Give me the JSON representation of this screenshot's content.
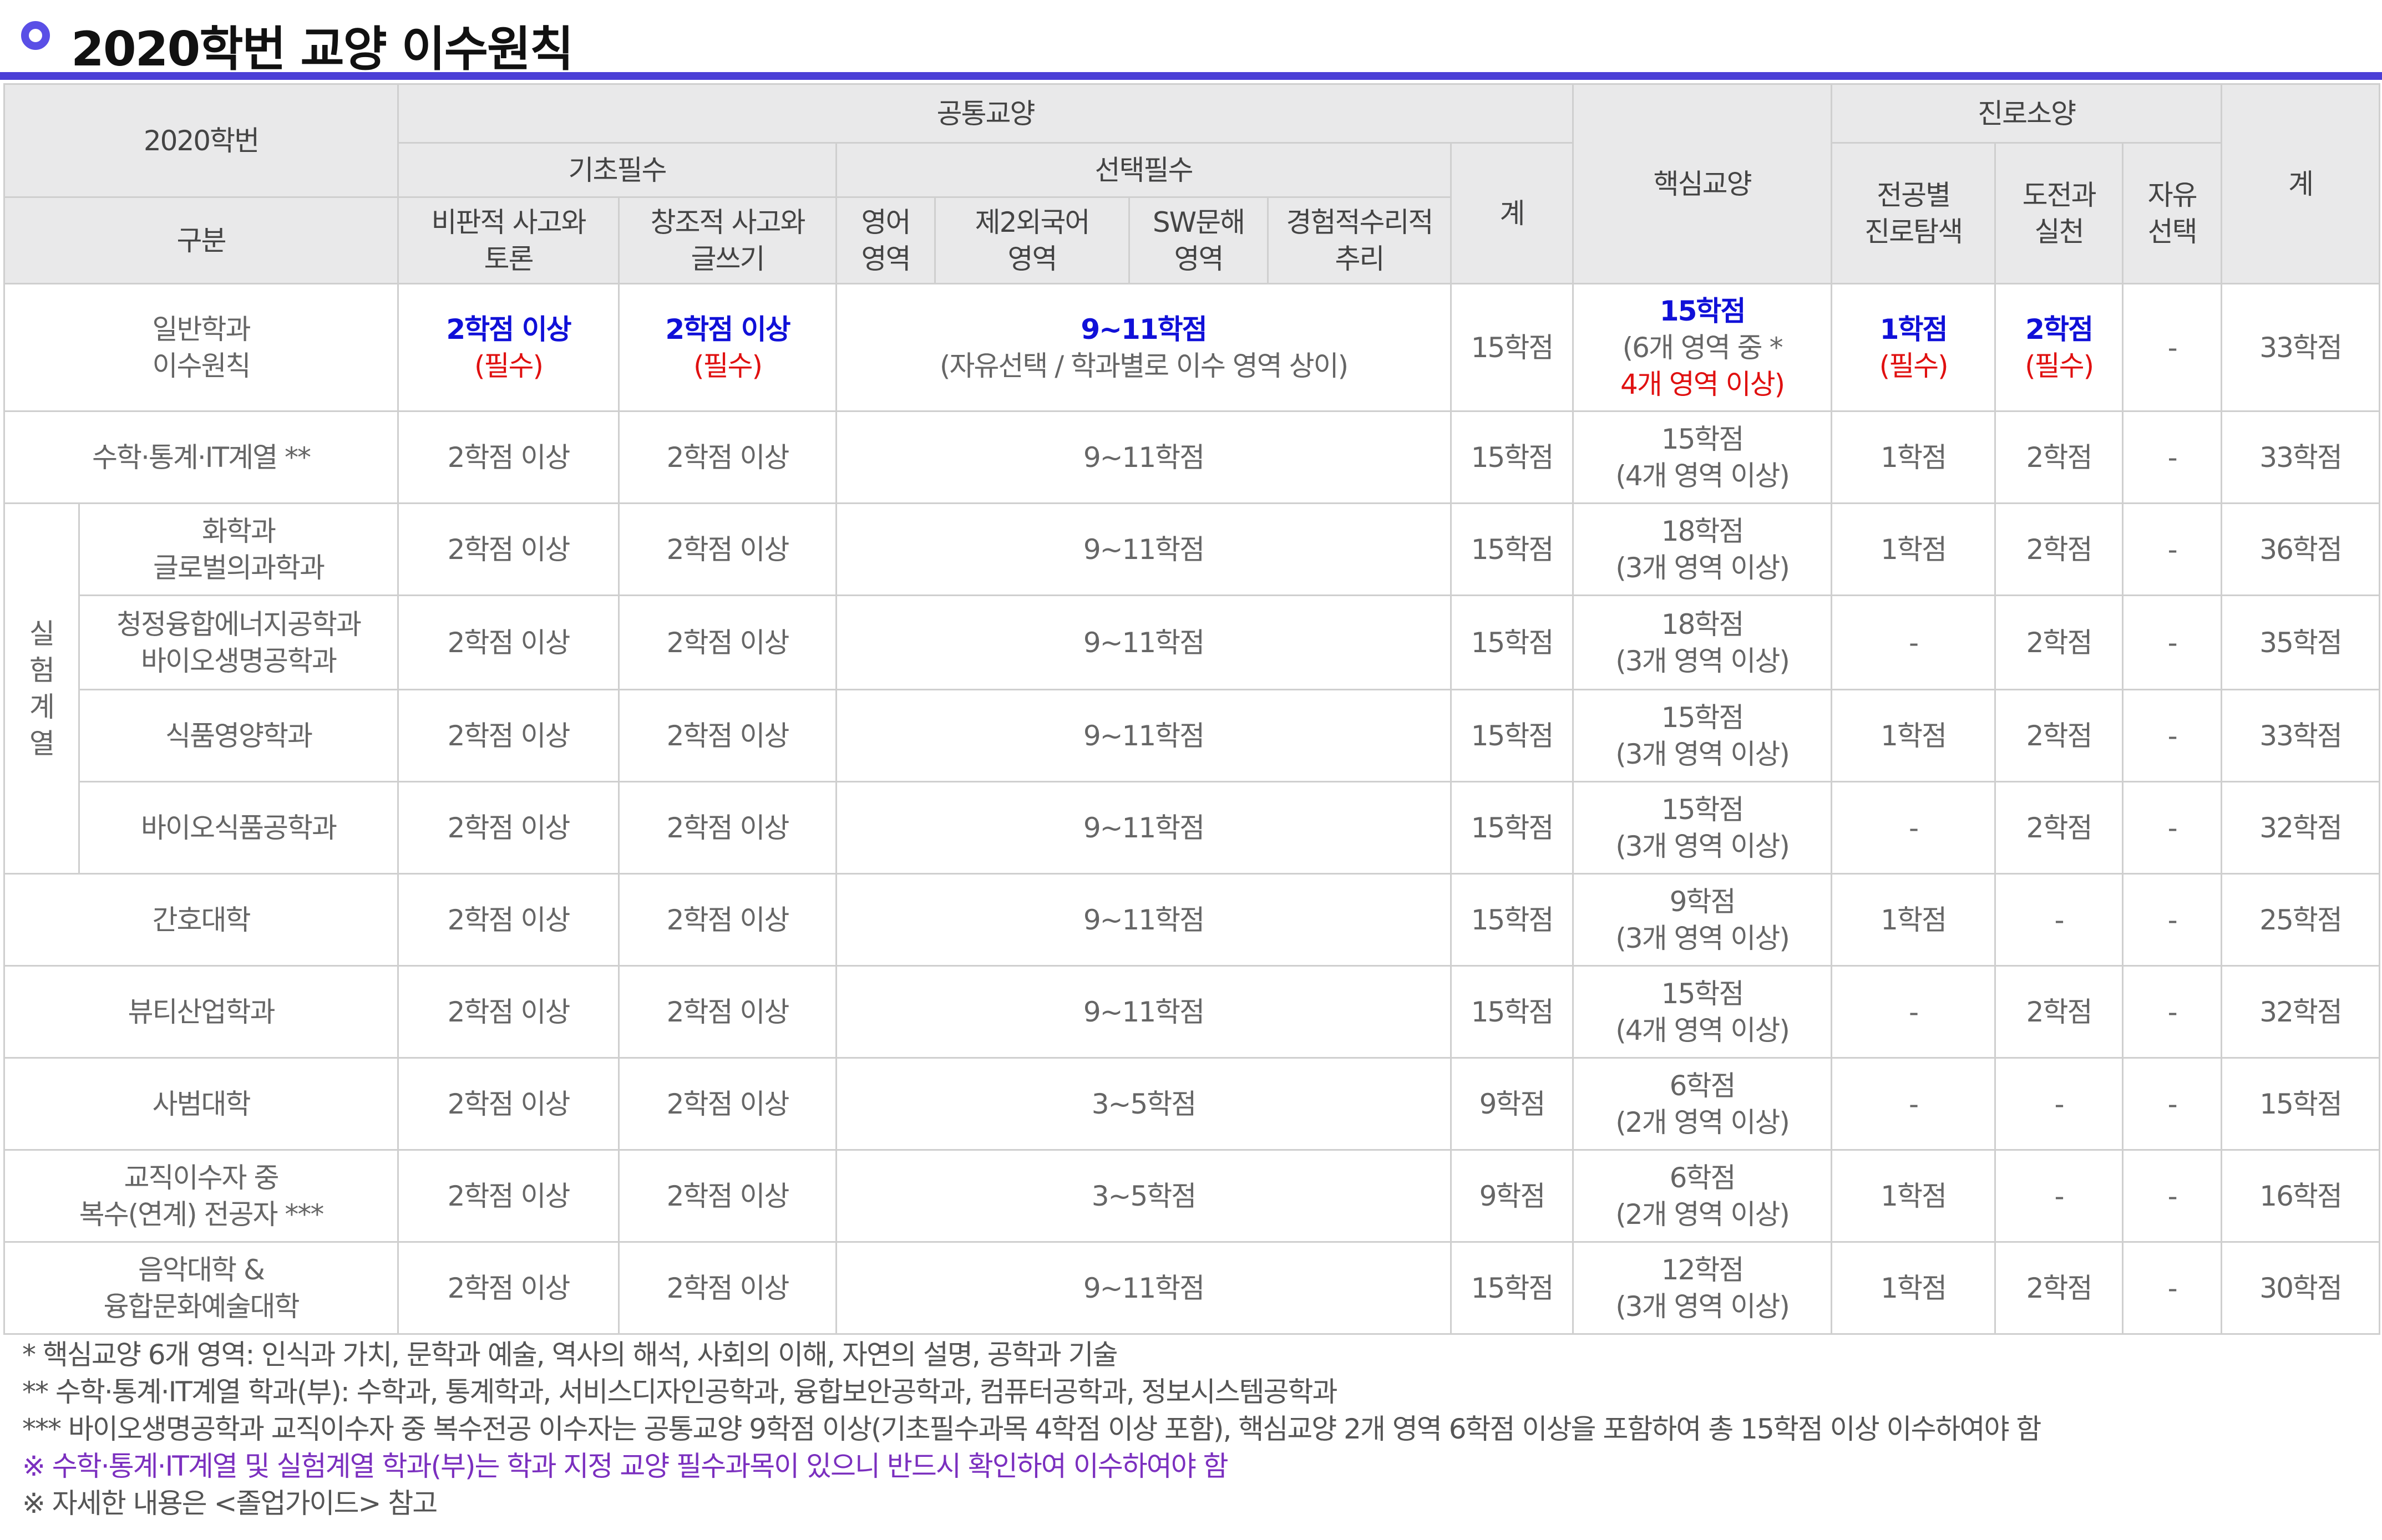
{
  "title": "2020학번 교양 이수원칙",
  "header": {
    "year_label": "2020학번",
    "gubun": "구분",
    "common": "공통교양",
    "basic_required": "기초필수",
    "elective_required": "선택필수",
    "critical_thinking": "비판적 사고와\n토론",
    "creative_thinking": "창조적 사고와\n글쓰기",
    "english": "영어\n영역",
    "second_lang": "제2외국어\n영역",
    "sw": "SW문해\n영역",
    "math": "경험적수리적\n추리",
    "subtotal": "계",
    "core": "핵심교양",
    "career": "진로소양",
    "major_explore": "전공별\n진로탐색",
    "challenge": "도전과\n실천",
    "free": "자유\n선택",
    "total": "계"
  },
  "general_row": {
    "name": "일반학과\n이수원칙",
    "critical": "2학점 이상",
    "critical_note": "(필수)",
    "creative": "2학점 이상",
    "creative_note": "(필수)",
    "elective": "9~11학점",
    "elective_note": "(자유선택 / 학과별로 이수 영역 상이)",
    "subtotal": "15학점",
    "core": "15학점",
    "core_note1": "(6개 영역 중 *",
    "core_note2": "4개 영역 이상)",
    "major_explore": "1학점",
    "major_explore_note": "(필수)",
    "challenge": "2학점",
    "challenge_note": "(필수)",
    "free": "-",
    "total": "33학점"
  },
  "experiment_label": "실\n험\n계\n열",
  "rows": [
    {
      "name": "수학·통계·IT계열 **",
      "critical": "2학점 이상",
      "creative": "2학점 이상",
      "elective": "9~11학점",
      "subtotal": "15학점",
      "core": "15학점",
      "core_note": "(4개 영역 이상)",
      "major_explore": "1학점",
      "challenge": "2학점",
      "free": "-",
      "total": "33학점"
    },
    {
      "name": "화학과\n글로벌의과학과",
      "critical": "2학점 이상",
      "creative": "2학점 이상",
      "elective": "9~11학점",
      "subtotal": "15학점",
      "core": "18학점",
      "core_note": "(3개 영역 이상)",
      "major_explore": "1학점",
      "challenge": "2학점",
      "free": "-",
      "total": "36학점"
    },
    {
      "name": "청정융합에너지공학과\n바이오생명공학과",
      "critical": "2학점 이상",
      "creative": "2학점 이상",
      "elective": "9~11학점",
      "subtotal": "15학점",
      "core": "18학점",
      "core_note": "(3개 영역 이상)",
      "major_explore": "-",
      "challenge": "2학점",
      "free": "-",
      "total": "35학점"
    },
    {
      "name": "식품영양학과",
      "critical": "2학점 이상",
      "creative": "2학점 이상",
      "elective": "9~11학점",
      "subtotal": "15학점",
      "core": "15학점",
      "core_note": "(3개 영역 이상)",
      "major_explore": "1학점",
      "challenge": "2학점",
      "free": "-",
      "total": "33학점"
    },
    {
      "name": "바이오식품공학과",
      "critical": "2학점 이상",
      "creative": "2학점 이상",
      "elective": "9~11학점",
      "subtotal": "15학점",
      "core": "15학점",
      "core_note": "(3개 영역 이상)",
      "major_explore": "-",
      "challenge": "2학점",
      "free": "-",
      "total": "32학점"
    },
    {
      "name": "간호대학",
      "critical": "2학점 이상",
      "creative": "2학점 이상",
      "elective": "9~11학점",
      "subtotal": "15학점",
      "core": "9학점",
      "core_note": "(3개 영역 이상)",
      "major_explore": "1학점",
      "challenge": "-",
      "free": "-",
      "total": "25학점"
    },
    {
      "name": "뷰티산업학과",
      "critical": "2학점 이상",
      "creative": "2학점 이상",
      "elective": "9~11학점",
      "subtotal": "15학점",
      "core": "15학점",
      "core_note": "(4개 영역 이상)",
      "major_explore": "-",
      "challenge": "2학점",
      "free": "-",
      "total": "32학점"
    },
    {
      "name": "사범대학",
      "critical": "2학점 이상",
      "creative": "2학점 이상",
      "elective": "3~5학점",
      "subtotal": "9학점",
      "core": "6학점",
      "core_note": "(2개 영역 이상)",
      "major_explore": "-",
      "challenge": "-",
      "free": "-",
      "total": "15학점"
    },
    {
      "name": "교직이수자 중\n복수(연계) 전공자 ***",
      "critical": "2학점 이상",
      "creative": "2학점 이상",
      "elective": "3~5학점",
      "subtotal": "9학점",
      "core": "6학점",
      "core_note": "(2개 영역 이상)",
      "major_explore": "1학점",
      "challenge": "-",
      "free": "-",
      "total": "16학점"
    },
    {
      "name": "음악대학 &\n융합문화예술대학",
      "critical": "2학점 이상",
      "creative": "2학점 이상",
      "elective": "9~11학점",
      "subtotal": "15학점",
      "core": "12학점",
      "core_note": "(3개 영역 이상)",
      "major_explore": "1학점",
      "challenge": "2학점",
      "free": "-",
      "total": "30학점"
    }
  ],
  "notes": [
    "*  핵심교양 6개 영역: 인식과 가치, 문학과 예술, 역사의 해석, 사회의 이해, 자연의 설명, 공학과 기술",
    "**  수학·통계·IT계열 학과(부): 수학과, 통계학과, 서비스디자인공학과, 융합보안공학과, 컴퓨터공학과, 정보시스템공학과",
    "***  바이오생명공학과 교직이수자 중 복수전공 이수자는 공통교양 9학점 이상(기초필수과목 4학점 이상 포함), 핵심교양 2개 영역 6학점 이상을 포함하여 총 15학점 이상 이수하여야 함",
    "※ 수학·통계·IT계열 및 실험계열 학과(부)는 학과 지정 교양 필수과목이 있으니 반드시 확인하여 이수하여야 함",
    "※  자세한  내용은 <졸업가이드> 참고"
  ],
  "colors": {
    "accent": "#4b3fd6",
    "blue": "#1010d8",
    "red": "#e01010",
    "purple": "#7b2fbf",
    "header_bg": "#e9e9ea"
  }
}
